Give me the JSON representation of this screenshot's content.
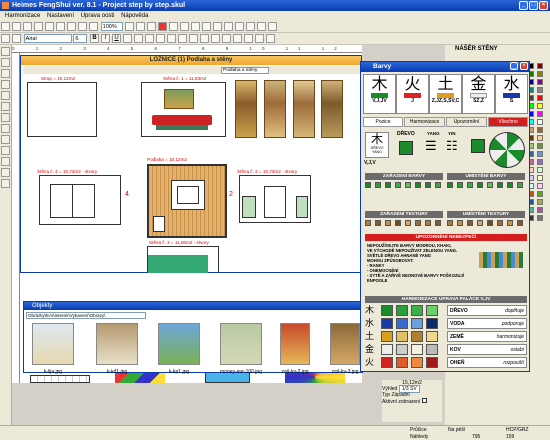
{
  "window": {
    "title": "Heimes FengShui ver. 8.1 - Project step by step.skul"
  },
  "menu": [
    "Harmonizace",
    "Nastavení",
    "Úprava oosti",
    "Nápověda"
  ],
  "toolbar": {
    "zoom": "100%",
    "font": "Arial",
    "font_size": "6"
  },
  "floor_window": {
    "title": "LOŽNICE (1) Podlaha a stěny",
    "dropdown": "Podlaha a stěny"
  },
  "plan_labels": {
    "strop": "Strop = 10,12m2",
    "wall1": "Stěna č. 1 = 11,83m2",
    "podlaha": "Podlaha = 10,12m2",
    "wall4": "Stěna č. 4 = 10,73m2 - stvory",
    "wall2": "Stěna č. 2 = 10,73m2 - stvory",
    "wall3": "Stěna č. 3 = 11,80m2 - stvory",
    "n4": "4",
    "n2": "2"
  },
  "objects_window": {
    "title": "Objekty",
    "path": "Obrázky\\EAI\\Interiér\\Vybavení\\Obrazy\\",
    "thumbs": [
      "k-lija.jpg",
      "k-kd1.jpg",
      "k-kp1.jpg",
      "money-eur-100.jpg",
      "zaš-kv-2.jpg",
      "zaš-kv-3.jpg"
    ]
  },
  "barvy_window": {
    "title": "Barvy",
    "elements": [
      {
        "char": "木",
        "name": "V,J,JV"
      },
      {
        "char": "火",
        "name": "J"
      },
      {
        "char": "土",
        "name": "Z,JZ,S,SV,C"
      },
      {
        "char": "金",
        "name": "SZ,Z"
      },
      {
        "char": "水",
        "name": "S"
      }
    ],
    "tabs": [
      "Pozice",
      "Harmonizace",
      "Upozornění",
      "Všechno"
    ],
    "drevo_label": "DŘEVO",
    "yang": "YANG",
    "yin": "YIN",
    "drevo_sub": "DŘEVO YANG",
    "vjv": "V,J,V",
    "sections": {
      "zarazeni_barvy": "ZAŘAZENÍ BARVY",
      "umisteni_barvy": "UMÍSTĚNÍ BARVY",
      "zarazeni_textury": "ZAŘAZENÍ TEXTURY",
      "umisteni_textury": "UMÍSTĚNÍ TEXTURY",
      "upozorneni": "UPOZORNĚNÍ NEBEZPEČÍ",
      "harmonizace": "HARMONIZACE ÚPRAVA PALÁCE  V,JV"
    },
    "warning_text": [
      "NEPOUŽÍVEJTE BARVY MODROU, KHAKI,",
      "VE VÝCHODĚ NEPOUŽÍVAT ZELENOU YANG.",
      "SVĚTLÉ DŘEVO AHNANÉ YANG",
      "MOHOU ZPŮSOBOVAT:",
      "- RANKY",
      "- ONEMOCNĚNÍ",
      "- SYTĚ A ZÁŘIVĚ NEONOVÉ BARVY POŠKOZUJÍ ENPOOLE"
    ],
    "harmonization": [
      {
        "char": "木",
        "name": "DŘEVO",
        "action": "doplňuje"
      },
      {
        "char": "水",
        "name": "VODA",
        "action": "podporuje"
      },
      {
        "char": "土",
        "name": "ZEMĚ",
        "action": "harmonizuje"
      },
      {
        "char": "金",
        "name": "KOV",
        "action": "oslabí"
      },
      {
        "char": "火",
        "name": "OHEŇ",
        "action": "rozpouští"
      }
    ]
  },
  "right_panel": {
    "title": "NÁŠĚR STĚNY"
  },
  "bottom_props": {
    "area": "15,12m2",
    "vyhled_label": "Výhled",
    "vyhled_val": "1/3 SV",
    "typ_label": "Typ",
    "typ_val": "Západní",
    "aktivni": "Aktivní zobrazení"
  },
  "status": {
    "x": "795",
    "y": "159",
    "mode": "HCP/GRZ",
    "s1": "Průčice",
    "s2": "Na pěší",
    "s3": "Náhledy"
  },
  "colors": {
    "accent": "#0a3cb0",
    "title_orange": "#f3a52e",
    "warning_red": "#d41d1d"
  }
}
